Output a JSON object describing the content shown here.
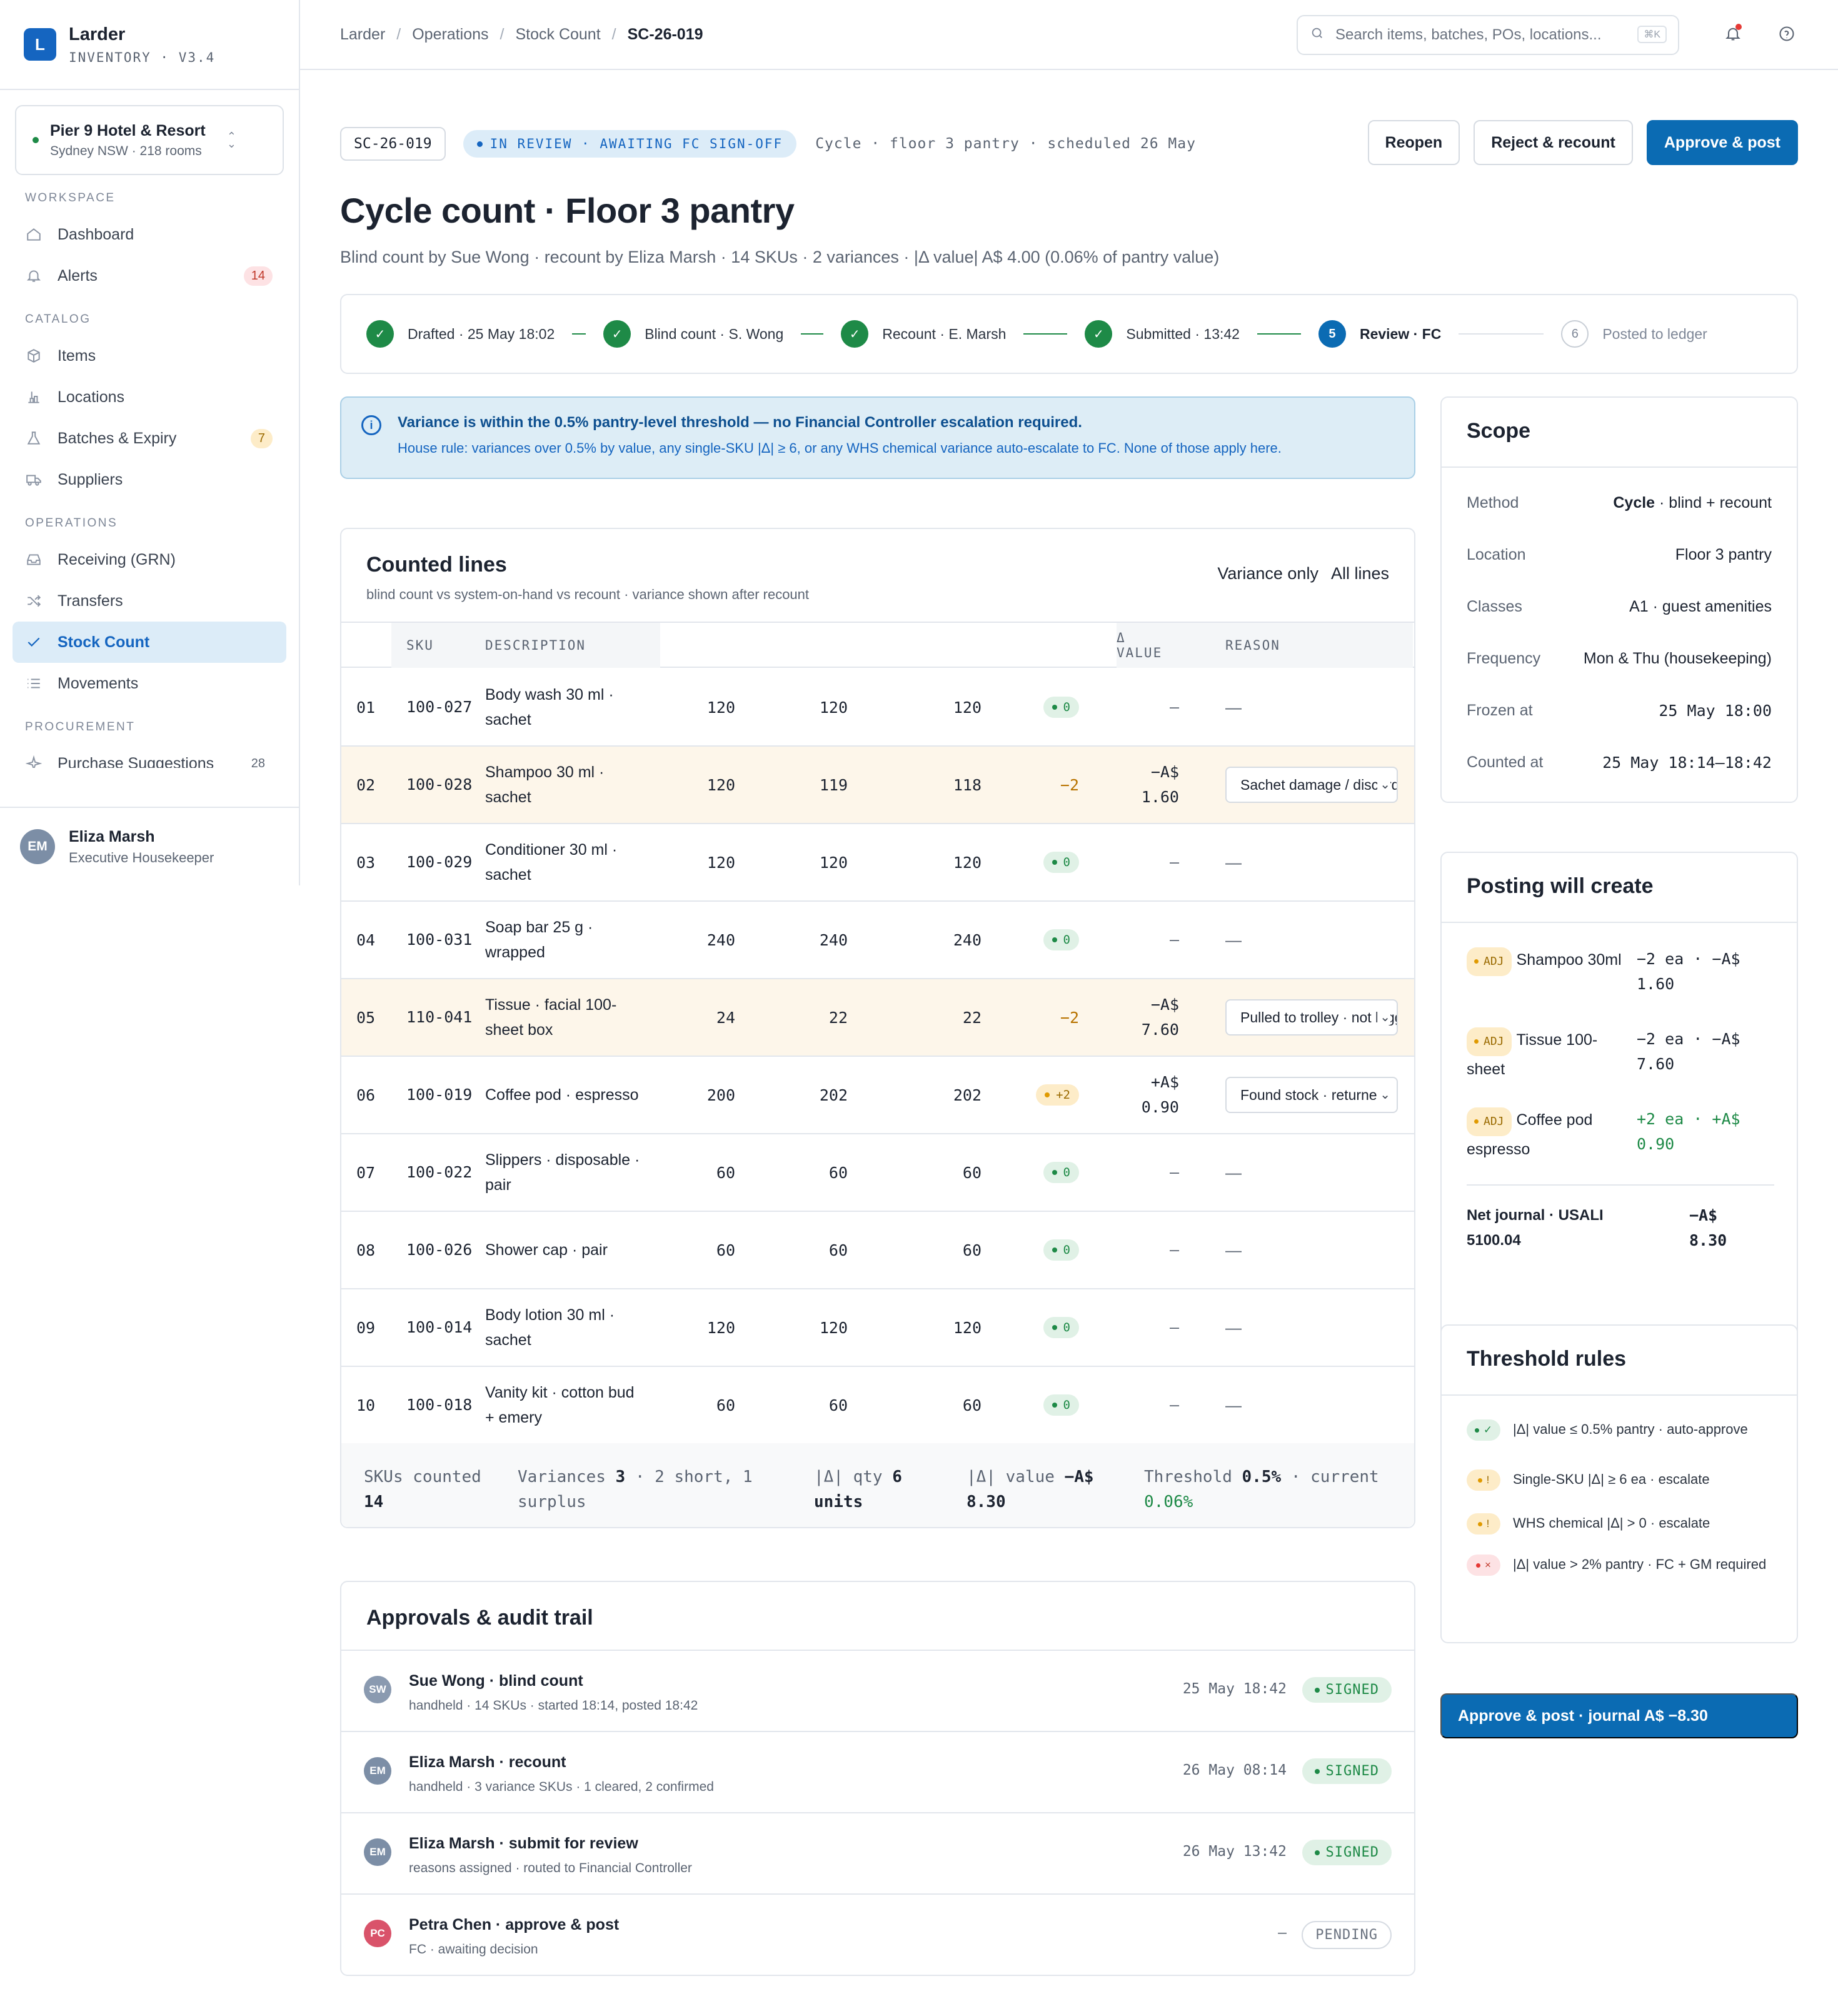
{
  "app": {
    "name": "Larder",
    "version": "INVENTORY · V3.4",
    "logo_letter": "L",
    "accent": "#0b6bb3"
  },
  "property": {
    "name": "Pier 9 Hotel & Resort",
    "sub": "Sydney NSW · 218 rooms"
  },
  "nav": {
    "workspace_label": "WORKSPACE",
    "dashboard": "Dashboard",
    "alerts": "Alerts",
    "alerts_badge": "14",
    "catalog_label": "CATALOG",
    "items": "Items",
    "locations": "Locations",
    "batches": "Batches & Expiry",
    "batches_badge": "7",
    "suppliers": "Suppliers",
    "operations_label": "OPERATIONS",
    "receiving": "Receiving (GRN)",
    "transfers": "Transfers",
    "stock_count": "Stock Count",
    "movements": "Movements",
    "procurement_label": "PROCUREMENT",
    "purchase_suggestions": "Purchase Suggestions",
    "purchase_badge": "28"
  },
  "user": {
    "initials": "EM",
    "name": "Eliza Marsh",
    "role": "Executive Housekeeper"
  },
  "breadcrumb": {
    "c1": "Larder",
    "c2": "Operations",
    "c3": "Stock Count",
    "c4": "SC-26-019",
    "sep": "/"
  },
  "search": {
    "placeholder": "Search items, batches, POs, locations...",
    "kbd": "⌘K"
  },
  "header": {
    "id": "SC-26-019",
    "status": "IN REVIEW · AWAITING FC SIGN-OFF",
    "meta": "Cycle · floor 3 pantry · scheduled 26 May",
    "reopen": "Reopen",
    "reject": "Reject & recount",
    "approve": "Approve & post",
    "title": "Cycle count · Floor 3 pantry",
    "subtitle": "Blind count by Sue Wong · recount by Eliza Marsh · 14 SKUs · 2 variances · |Δ value| A$ 4.00 (0.06% of pantry value)"
  },
  "steps": [
    {
      "label": "Drafted · 25 May 18:02",
      "mark": "✓"
    },
    {
      "label": "Blind count · S. Wong",
      "mark": "✓"
    },
    {
      "label": "Recount · E. Marsh",
      "mark": "✓"
    },
    {
      "label": "Submitted · 13:42",
      "mark": "✓"
    },
    {
      "label": "Review · FC",
      "mark": "5"
    },
    {
      "label": "Posted to ledger",
      "mark": "6"
    }
  ],
  "callout": {
    "title": "Variance is within the 0.5% pantry-level threshold — no Financial Controller escalation required.",
    "body": "House rule: variances over 0.5% by value, any single-SKU |Δ| ≥ 6, or any WHS chemical variance auto-escalate to FC. None of those apply here."
  },
  "lines": {
    "title": "Counted lines",
    "subtitle": "blind count vs system-on-hand vs recount · variance shown after recount",
    "filter_variance": "Variance only",
    "filter_all": "All lines",
    "col_sku": "SKU",
    "col_desc": "DESCRIPTION",
    "col_value": "Δ VALUE",
    "col_reason": "REASON",
    "rows": [
      {
        "n": "01",
        "sku": "100-027",
        "desc": "Body wash 30 ml · sachet",
        "sys": "120",
        "blind": "120",
        "rec": "120",
        "var": "0",
        "val": "—",
        "reason": "—"
      },
      {
        "n": "02",
        "sku": "100-028",
        "desc": "Shampoo 30 ml · sachet",
        "sys": "120",
        "blind": "119",
        "rec": "118",
        "var": "−2",
        "val": "−A$ 1.60",
        "reason": "Sachet damage / discard"
      },
      {
        "n": "03",
        "sku": "100-029",
        "desc": "Conditioner 30 ml · sachet",
        "sys": "120",
        "blind": "120",
        "rec": "120",
        "var": "0",
        "val": "—",
        "reason": "—"
      },
      {
        "n": "04",
        "sku": "100-031",
        "desc": "Soap bar 25 g · wrapped",
        "sys": "240",
        "blind": "240",
        "rec": "240",
        "var": "0",
        "val": "—",
        "reason": "—"
      },
      {
        "n": "05",
        "sku": "110-041",
        "desc": "Tissue · facial 100-sheet box",
        "sys": "24",
        "blind": "22",
        "rec": "22",
        "var": "−2",
        "val": "−A$ 7.60",
        "reason": "Pulled to trolley · not logged"
      },
      {
        "n": "06",
        "sku": "100-019",
        "desc": "Coffee pod · espresso",
        "sys": "200",
        "blind": "202",
        "rec": "202",
        "var": "+2",
        "val": "+A$ 0.90",
        "reason": "Found stock · returned"
      },
      {
        "n": "07",
        "sku": "100-022",
        "desc": "Slippers · disposable · pair",
        "sys": "60",
        "blind": "60",
        "rec": "60",
        "var": "0",
        "val": "—",
        "reason": "—"
      },
      {
        "n": "08",
        "sku": "100-026",
        "desc": "Shower cap · pair",
        "sys": "60",
        "blind": "60",
        "rec": "60",
        "var": "0",
        "val": "—",
        "reason": "—"
      },
      {
        "n": "09",
        "sku": "100-014",
        "desc": "Body lotion 30 ml · sachet",
        "sys": "120",
        "blind": "120",
        "rec": "120",
        "var": "0",
        "val": "—",
        "reason": "—"
      },
      {
        "n": "10",
        "sku": "100-018",
        "desc": "Vanity kit · cotton bud + emery",
        "sys": "60",
        "blind": "60",
        "rec": "60",
        "var": "0",
        "val": "—",
        "reason": "—"
      }
    ],
    "footer": {
      "skus_label": "SKUs counted",
      "skus_value": "14",
      "variances_label": "Variances",
      "variances_value": "3",
      "variances_detail": "· 2 short, 1 surplus",
      "qty_label": "|Δ| qty",
      "qty_value": "6 units",
      "value_label": "|Δ| value",
      "value_value": "−A$ 8.30",
      "threshold_label": "Threshold",
      "threshold_value": "0.5%",
      "current_label": "· current",
      "current_value": "0.06%"
    }
  },
  "approvals": {
    "title": "Approvals & audit trail",
    "rows": [
      {
        "initials": "SW",
        "name": "Sue Wong · blind count",
        "sub": "handheld · 14 SKUs · started 18:14, posted 18:42",
        "time": "25 May 18:42",
        "status": "SIGNED",
        "color": "#8a9ab0"
      },
      {
        "initials": "EM",
        "name": "Eliza Marsh · recount",
        "sub": "handheld · 3 variance SKUs · 1 cleared, 2 confirmed",
        "time": "26 May 08:14",
        "status": "SIGNED",
        "color": "#7c8ea6"
      },
      {
        "initials": "EM",
        "name": "Eliza Marsh · submit for review",
        "sub": "reasons assigned · routed to Financial Controller",
        "time": "26 May 13:42",
        "status": "SIGNED",
        "color": "#7c8ea6"
      },
      {
        "initials": "PC",
        "name": "Petra Chen · approve & post",
        "sub": "FC · awaiting decision",
        "time": "—",
        "status": "PENDING",
        "color": "#d9536a"
      }
    ]
  },
  "scope": {
    "title": "Scope",
    "method_k": "Method",
    "method_bold": "Cycle",
    "method_rest": " · blind + recount",
    "location_k": "Location",
    "location_v": "Floor 3 pantry",
    "classes_k": "Classes",
    "classes_v": "A1 · guest amenities",
    "frequency_k": "Frequency",
    "frequency_v": "Mon & Thu (housekeeping)",
    "frozen_k": "Frozen at",
    "frozen_v": "25 May 18:00",
    "counted_k": "Counted at",
    "counted_v": "25 May 18:14–18:42"
  },
  "posting": {
    "title": "Posting will create",
    "adj_tag": "ADJ",
    "items": [
      {
        "label": "Shampoo 30ml",
        "amount": "−2 ea · −A$ 1.60",
        "positive": false
      },
      {
        "label": "Tissue 100-sheet",
        "amount": "−2 ea · −A$ 7.60",
        "positive": false
      },
      {
        "label": "Coffee pod espresso",
        "amount": "+2 ea · +A$ 0.90",
        "positive": true
      }
    ],
    "net_label": "Net journal · USALI 5100.04",
    "net_value": "−A$ 8.30"
  },
  "rules": {
    "title": "Threshold rules",
    "items": [
      {
        "mark": "✓",
        "text": "|Δ| value ≤ 0.5% pantry · auto-approve",
        "kind": "g"
      },
      {
        "mark": "!",
        "text": "Single-SKU |Δ| ≥ 6 ea · escalate",
        "kind": "a"
      },
      {
        "mark": "!",
        "text": "WHS chemical |Δ| > 0 · escalate",
        "kind": "a"
      },
      {
        "mark": "×",
        "text": "|Δ| value > 2% pantry · FC + GM required",
        "kind": "r"
      }
    ]
  },
  "cta": {
    "label": "Approve & post · journal A$ −8.30"
  }
}
